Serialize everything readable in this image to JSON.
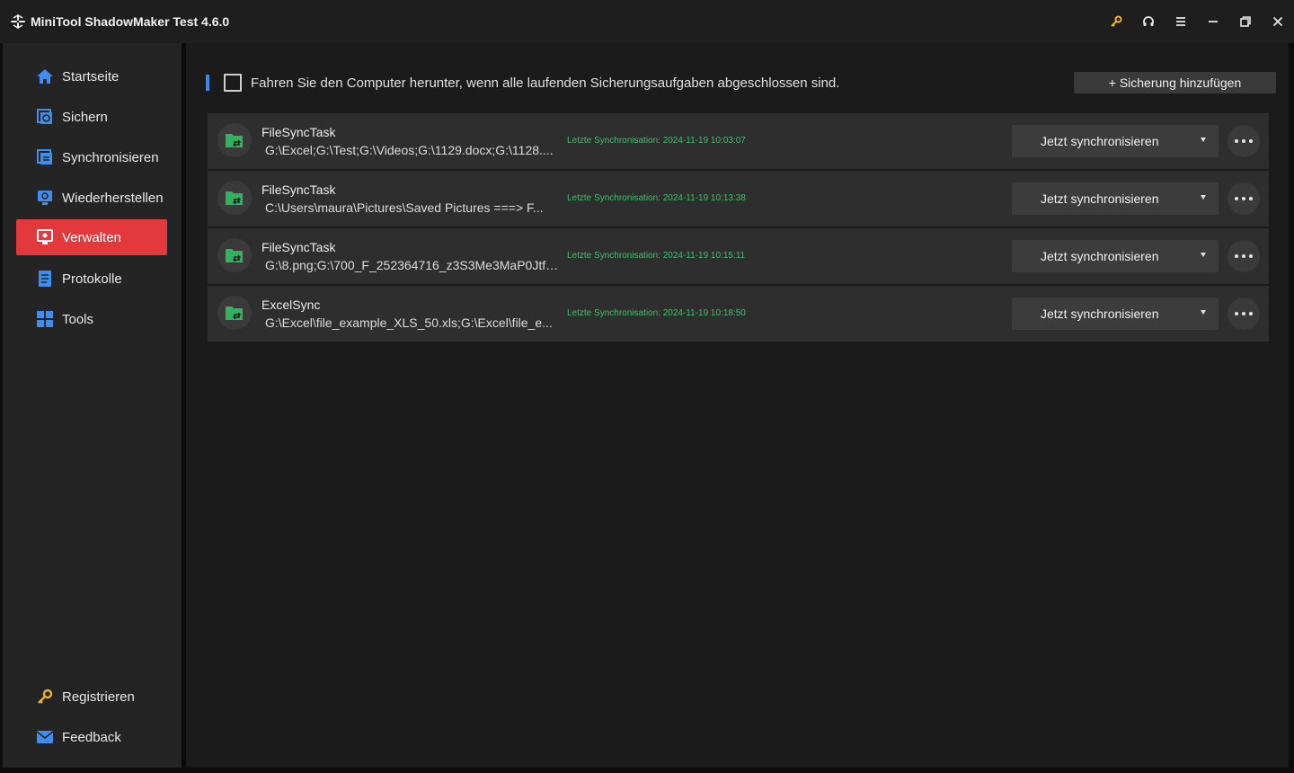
{
  "window": {
    "title": "MiniTool ShadowMaker Test 4.6.0",
    "controls": [
      "key-icon",
      "headset-icon",
      "menu-icon",
      "minimize-icon",
      "restore-icon",
      "close-icon"
    ]
  },
  "sidebar": {
    "items": [
      {
        "label": "Startseite",
        "icon": "home-icon",
        "active": false
      },
      {
        "label": "Sichern",
        "icon": "backup-icon",
        "active": false
      },
      {
        "label": "Synchronisieren",
        "icon": "sync-icon",
        "active": false
      },
      {
        "label": "Wiederherstellen",
        "icon": "restore-icon",
        "active": false
      },
      {
        "label": "Verwalten",
        "icon": "manage-icon",
        "active": true
      },
      {
        "label": "Protokolle",
        "icon": "logs-icon",
        "active": false
      },
      {
        "label": "Tools",
        "icon": "tools-icon",
        "active": false
      }
    ],
    "bottom": [
      {
        "label": "Registrieren",
        "icon": "key-icon"
      },
      {
        "label": "Feedback",
        "icon": "mail-icon"
      }
    ]
  },
  "main": {
    "shutdown_label": "Fahren Sie den Computer herunter, wenn alle laufenden Sicherungsaufgaben abgeschlossen sind.",
    "shutdown_checked": false,
    "add_button": "+ Sicherung hinzufügen",
    "tasks": [
      {
        "name": "FileSyncTask",
        "path": "G:\\Excel;G:\\Test;G:\\Videos;G:\\1129.docx;G:\\1128....",
        "last": "Letzte Synchronisation: 2024-11-19 10:03:07",
        "action": "Jetzt synchronisieren"
      },
      {
        "name": "FileSyncTask",
        "path": "C:\\Users\\maura\\Pictures\\Saved Pictures ===> F...",
        "last": "Letzte Synchronisation: 2024-11-19 10:13:38",
        "action": "Jetzt synchronisieren"
      },
      {
        "name": "FileSyncTask",
        "path": "G:\\8.png;G:\\700_F_252364716_z3S3Me3MaP0JtfJ...",
        "last": "Letzte Synchronisation: 2024-11-19 10:15:11",
        "action": "Jetzt synchronisieren"
      },
      {
        "name": "ExcelSync",
        "path": "G:\\Excel\\file_example_XLS_50.xls;G:\\Excel\\file_e...",
        "last": "Letzte Synchronisation: 2024-11-19 10:18:50",
        "action": "Jetzt synchronisieren"
      }
    ]
  },
  "colors": {
    "accent_red": "#e3393c",
    "accent_blue": "#2d8cf0",
    "status_green": "#3fbf6f",
    "key_gold": "#f0b429"
  }
}
